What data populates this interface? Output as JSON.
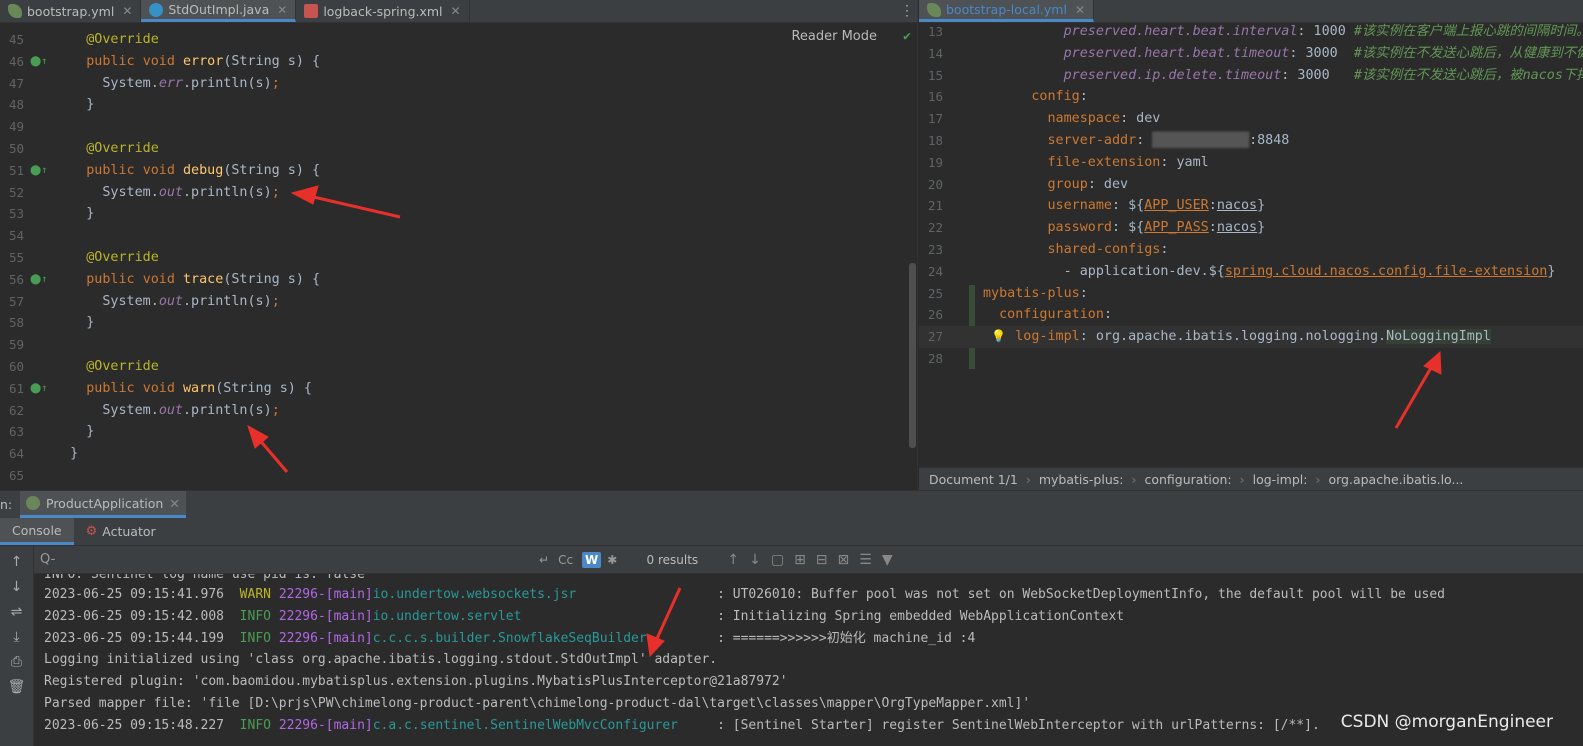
{
  "tabs_left": [
    {
      "label": "bootstrap.yml",
      "icon": "yml-file-icon"
    },
    {
      "label": "StdOutImpl.java",
      "icon": "java-class-icon",
      "active": true
    },
    {
      "label": "logback-spring.xml",
      "icon": "xml-file-icon"
    }
  ],
  "tabs_right": [
    {
      "label": "bootstrap-local.yml",
      "icon": "yml-file-icon",
      "active": true
    }
  ],
  "left_editor": {
    "reader_mode": "Reader Mode",
    "lines": [
      {
        "n": "45",
        "code": "    @Override"
      },
      {
        "n": "46",
        "code": "    public void error(String s) {"
      },
      {
        "n": "47",
        "code": "      System.err.println(s);"
      },
      {
        "n": "48",
        "code": "    }"
      },
      {
        "n": "49",
        "code": ""
      },
      {
        "n": "50",
        "code": "    @Override"
      },
      {
        "n": "51",
        "code": "    public void debug(String s) {"
      },
      {
        "n": "52",
        "code": "      System.out.println(s);"
      },
      {
        "n": "53",
        "code": "    }"
      },
      {
        "n": "54",
        "code": ""
      },
      {
        "n": "55",
        "code": "    @Override"
      },
      {
        "n": "56",
        "code": "    public void trace(String s) {"
      },
      {
        "n": "57",
        "code": "      System.out.println(s);"
      },
      {
        "n": "58",
        "code": "    }"
      },
      {
        "n": "59",
        "code": ""
      },
      {
        "n": "60",
        "code": "    @Override"
      },
      {
        "n": "61",
        "code": "    public void warn(String s) {"
      },
      {
        "n": "62",
        "code": "      System.out.println(s);"
      },
      {
        "n": "63",
        "code": "    }"
      },
      {
        "n": "64",
        "code": "  }"
      },
      {
        "n": "65",
        "code": ""
      }
    ]
  },
  "right_editor": {
    "lines": [
      {
        "n": "13",
        "key": "preserved.heart.beat.interval",
        "val": " 1000 ",
        "comment": "#该实例在客户端上报心跳的间隔时间。",
        "indent": "          "
      },
      {
        "n": "14",
        "key": "preserved.heart.beat.timeout",
        "val": " 3000  ",
        "comment": "#该实例在不发送心跳后，从健康到不健",
        "indent": "          "
      },
      {
        "n": "15",
        "key": "preserved.ip.delete.timeout",
        "val": " 3000   ",
        "comment": "#该实例在不发送心跳后，被nacos下掉",
        "indent": "          "
      },
      {
        "n": "16",
        "key": "config",
        "val": "",
        "comment": "",
        "indent": "      "
      },
      {
        "n": "17",
        "key": "namespace",
        "val": " dev",
        "comment": "",
        "indent": "        "
      },
      {
        "n": "18",
        "key": "server-addr",
        "val": " ████████████:8848",
        "comment": "",
        "indent": "        "
      },
      {
        "n": "19",
        "key": "file-extension",
        "val": " yaml",
        "comment": "",
        "indent": "        "
      },
      {
        "n": "20",
        "key": "group",
        "val": " dev",
        "comment": "",
        "indent": "        "
      },
      {
        "n": "21",
        "key": "username",
        "val": " ${APP_USER:nacos}",
        "comment": "",
        "indent": "        "
      },
      {
        "n": "22",
        "key": "password",
        "val": " ${APP_PASS:nacos}",
        "comment": "",
        "indent": "        "
      },
      {
        "n": "23",
        "key": "shared-configs",
        "val": "",
        "comment": "",
        "indent": "        "
      },
      {
        "n": "24",
        "key": "",
        "val": "- application-dev.${spring.cloud.nacos.config.file-extension}",
        "comment": "",
        "indent": "          "
      },
      {
        "n": "25",
        "key": "mybatis-plus",
        "val": "",
        "comment": "",
        "indent": ""
      },
      {
        "n": "26",
        "key": "configuration",
        "val": "",
        "comment": "",
        "indent": "  "
      },
      {
        "n": "27",
        "key": "log-impl",
        "val": " org.apache.ibatis.logging.nologging.NoLoggingImpl",
        "comment": "",
        "indent": "    "
      },
      {
        "n": "28",
        "key": "",
        "val": "",
        "comment": "",
        "indent": ""
      }
    ]
  },
  "breadcrumb": [
    "Document 1/1",
    "mybatis-plus:",
    "configuration:",
    "log-impl:",
    "org.apache.ibatis.lo..."
  ],
  "run_panel": {
    "prefix": "n:",
    "run_tab": "ProductApplication",
    "sub_tabs": [
      "Console",
      "Actuator"
    ],
    "search_placeholder": "Q-",
    "results": "0 results"
  },
  "console_lines": [
    {
      "raw": "INFO: Sentinel log name use pid is: false"
    },
    {
      "date": "2023-06-25 09:15:41.976",
      "level": "WARN",
      "thread": "22296-[main]",
      "logger": "io.undertow.websockets.jsr                ",
      "msg": "  : UT026010: Buffer pool was not set on WebSocketDeploymentInfo, the default pool will be used"
    },
    {
      "date": "2023-06-25 09:15:42.008",
      "level": "INFO",
      "thread": "22296-[main]",
      "logger": "io.undertow.servlet                       ",
      "msg": "  : Initializing Spring embedded WebApplicationContext"
    },
    {
      "date": "2023-06-25 09:15:44.199",
      "level": "INFO",
      "thread": "22296-[main]",
      "logger": "c.c.c.s.builder.SnowflakeSeqBuilder       ",
      "msg": "  : ======>>>>>>初始化 machine_id :4"
    },
    {
      "raw": "Logging initialized using 'class org.apache.ibatis.logging.stdout.StdOutImpl' adapter."
    },
    {
      "raw": "Registered plugin: 'com.baomidou.mybatisplus.extension.plugins.MybatisPlusInterceptor@21a87972'"
    },
    {
      "raw": "Parsed mapper file: 'file [D:\\prjs\\PW\\chimelong-product-parent\\chimelong-product-dal\\target\\classes\\mapper\\OrgTypeMapper.xml]'"
    },
    {
      "date": "2023-06-25 09:15:48.227",
      "level": "INFO",
      "thread": "22296-[main]",
      "logger": "c.a.c.sentinel.SentinelWebMvcConfigurer   ",
      "msg": "  : [Sentinel Starter] register SentinelWebInterceptor with urlPatterns: [/**]."
    }
  ],
  "watermark": "CSDN @morganEngineer",
  "colors": {
    "accent": "#4a88c7",
    "arrow": "#e8302a",
    "keyword": "#cc7832",
    "annotation": "#bbb529"
  }
}
